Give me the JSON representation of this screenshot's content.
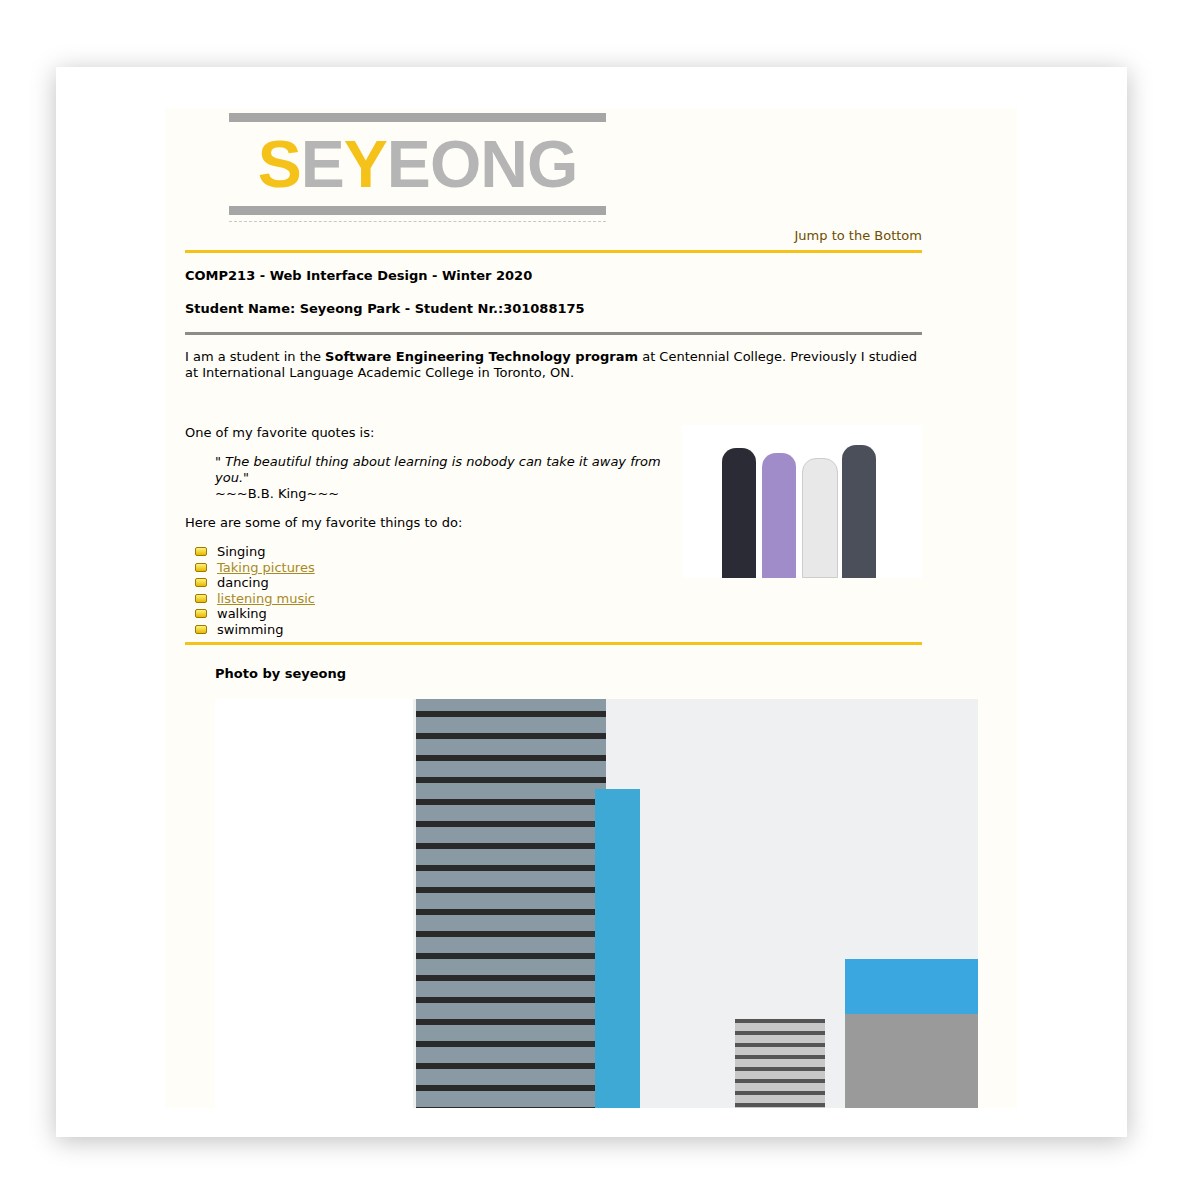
{
  "logo": {
    "segments": [
      {
        "text": "S",
        "highlight": true
      },
      {
        "text": "E",
        "highlight": false
      },
      {
        "text": "Y",
        "highlight": true
      },
      {
        "text": "EONG",
        "highlight": false
      }
    ]
  },
  "nav": {
    "jump_link": "Jump to the Bottom"
  },
  "header": {
    "course": "COMP213 - Web Interface Design - Winter 2020",
    "student": "Student Name: Seyeong Park - Student Nr.:301088175"
  },
  "intro": {
    "before": "I am a student in the ",
    "bold": "Software Engineering Technology program",
    "after": " at Centennial College. Previously I studied at International Language Academic College in Toronto, ON."
  },
  "quote": {
    "lead": "One of my favorite quotes is:",
    "text": "\" The beautiful thing about learning is nobody can take it away from you.\"",
    "author": "~~~B.B. King~~~"
  },
  "favorites": {
    "lead": "Here are some of my favorite things to do:",
    "items": [
      {
        "label": "Singing",
        "link": false
      },
      {
        "label": "Taking pictures",
        "link": true
      },
      {
        "label": "dancing",
        "link": false
      },
      {
        "label": "listening music",
        "link": true
      },
      {
        "label": "walking",
        "link": false
      },
      {
        "label": "swimming",
        "link": false
      }
    ]
  },
  "gallery": {
    "caption": "Photo by seyeong"
  }
}
